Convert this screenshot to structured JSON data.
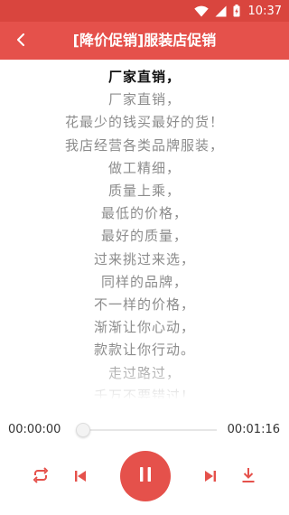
{
  "status_bar": {
    "time": "10:37",
    "icons": [
      "wifi-icon",
      "signal-icon",
      "battery-icon"
    ]
  },
  "toolbar": {
    "title": "[降价促销]服装店促销",
    "back_icon": "chevron-left-icon"
  },
  "lyrics": {
    "lines": [
      "厂家直销，",
      "厂家直销，",
      "花最少的钱买最好的货！",
      "我店经营各类品牌服装，",
      "做工精细，",
      "质量上乘，",
      "最低的价格，",
      "最好的质量，",
      "过来挑过来选，",
      "同样的品牌，",
      "不一样的价格，",
      "渐渐让你心动，",
      "款款让你行动。",
      "走过路过，",
      "千万不要错过！"
    ],
    "active_index": 0
  },
  "player": {
    "current_time": "00:00:00",
    "total_time": "00:01:16",
    "progress": 0
  },
  "controls": {
    "repeat_icon": "repeat-icon",
    "prev_icon": "skip-previous-icon",
    "play_icon": "pause-icon",
    "next_icon": "skip-next-icon",
    "download_icon": "download-icon"
  },
  "colors": {
    "accent": "#e5514b",
    "status_bar": "#d9453e",
    "lyric_active": "#111111",
    "lyric_inactive": "#8c8c8c"
  }
}
